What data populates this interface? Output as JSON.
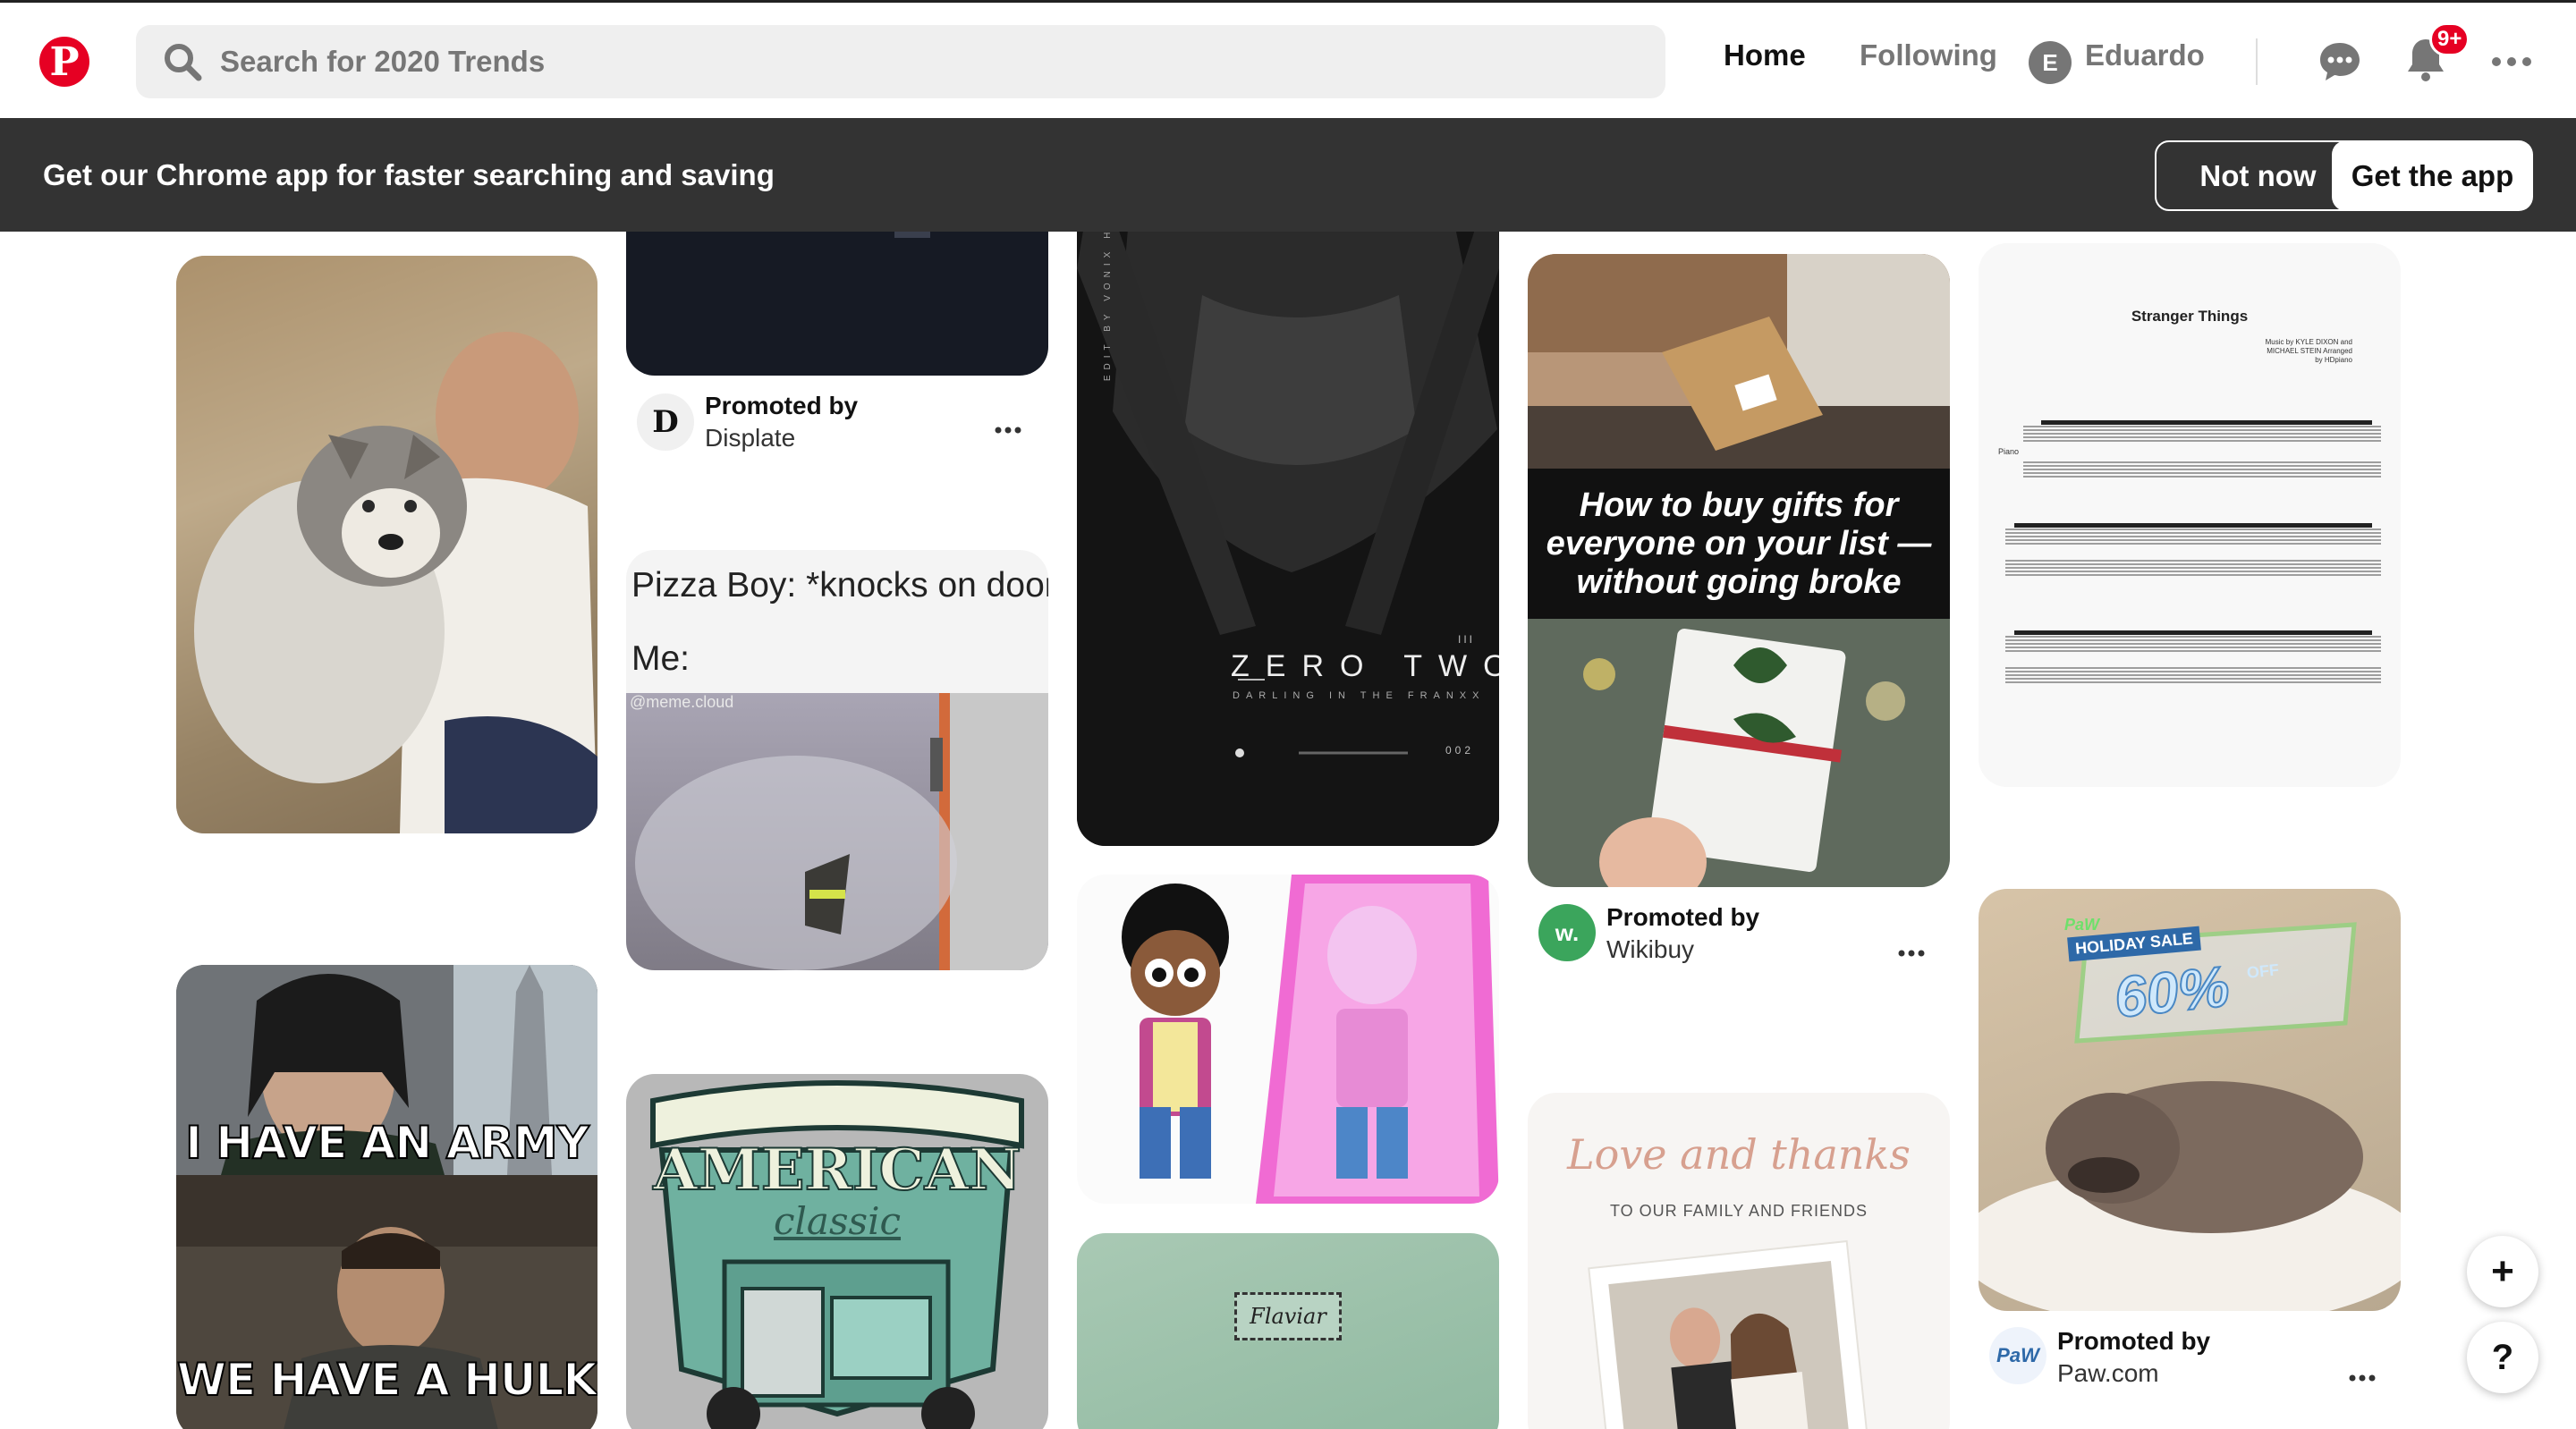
{
  "header": {
    "logo_letter": "P",
    "search_placeholder": "Search for 2020 Trends",
    "nav_home": "Home",
    "nav_following": "Following",
    "user_initial": "E",
    "user_name": "Eduardo",
    "notifications_badge": "9+"
  },
  "banner": {
    "message": "Get our Chrome app for faster searching and saving",
    "not_now": "Not now",
    "get_app": "Get the app"
  },
  "pins": {
    "displate": {
      "promoted": "Promoted by",
      "advertiser": "Displate",
      "logo_letter": "D"
    },
    "pizza": {
      "line1": "Pizza Boy: *knocks on door*",
      "line2": "Me:",
      "watermark": "@meme.cloud"
    },
    "zerotwo": {
      "title": "ZERO TWO",
      "subtitle": "DARLING IN THE FRANXX",
      "side_text": "EDIT BY VONIX HI",
      "counter": "002",
      "mark": "III"
    },
    "wikibuy": {
      "headline": "How to buy gifts for everyone on your list — without going broke",
      "promoted": "Promoted by",
      "advertiser": "Wikibuy",
      "logo_letter": "w."
    },
    "sheet": {
      "title": "Stranger Things",
      "credits": "Music by KYLE DIXON and MICHAEL STEIN Arranged by HDpiano",
      "instrument": "Piano"
    },
    "paw": {
      "promoted": "Promoted by",
      "advertiser": "Paw.com",
      "logo_text": "PaW",
      "sale_brand": "PaW",
      "sale_label": "HOLIDAY SALE",
      "discount": "60%",
      "discount_suffix": "OFF"
    },
    "loki": {
      "top_text": "I HAVE AN ARMY",
      "bottom_text": "WE HAVE A HULK"
    },
    "american": {
      "title": "AMERICAN",
      "script": "classic"
    },
    "flaviar": {
      "label": "Flaviar"
    },
    "wedding": {
      "script": "Love and thanks",
      "subtitle": "TO OUR FAMILY AND FRIENDS"
    }
  },
  "fab": {
    "add": "+",
    "help": "?"
  },
  "colors": {
    "brand": "#e60023",
    "banner_bg": "#333333",
    "search_bg": "#efefef"
  }
}
